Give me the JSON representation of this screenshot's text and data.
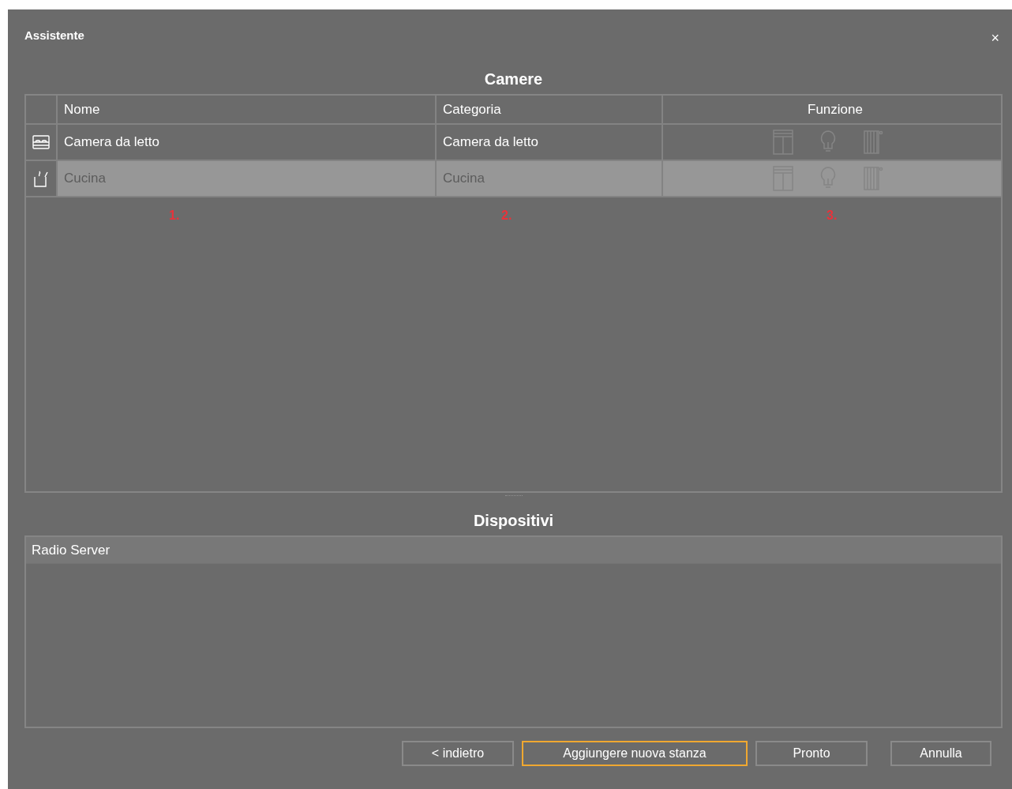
{
  "window": {
    "title": "Assistente",
    "close": "×"
  },
  "rooms": {
    "title": "Camere",
    "columns": [
      "Nome",
      "Categoria",
      "Funzione"
    ],
    "rows": [
      {
        "kind": "bedroom",
        "name": "Camera da letto",
        "category": "Camera da letto",
        "selected": false
      },
      {
        "kind": "kitchen",
        "name": "Cucina",
        "category": "Cucina",
        "selected": true
      }
    ],
    "annotations": [
      "1.",
      "2.",
      "3."
    ]
  },
  "devices": {
    "title": "Dispositivi",
    "items": [
      {
        "name": "Radio Server",
        "selected": true
      }
    ]
  },
  "buttons": [
    {
      "label": "< indietro",
      "focused": false
    },
    {
      "label": "Aggiungere nuova stanza",
      "focused": true
    },
    {
      "label": "Pronto",
      "focused": false
    },
    {
      "label": "Annulla",
      "focused": false
    }
  ]
}
